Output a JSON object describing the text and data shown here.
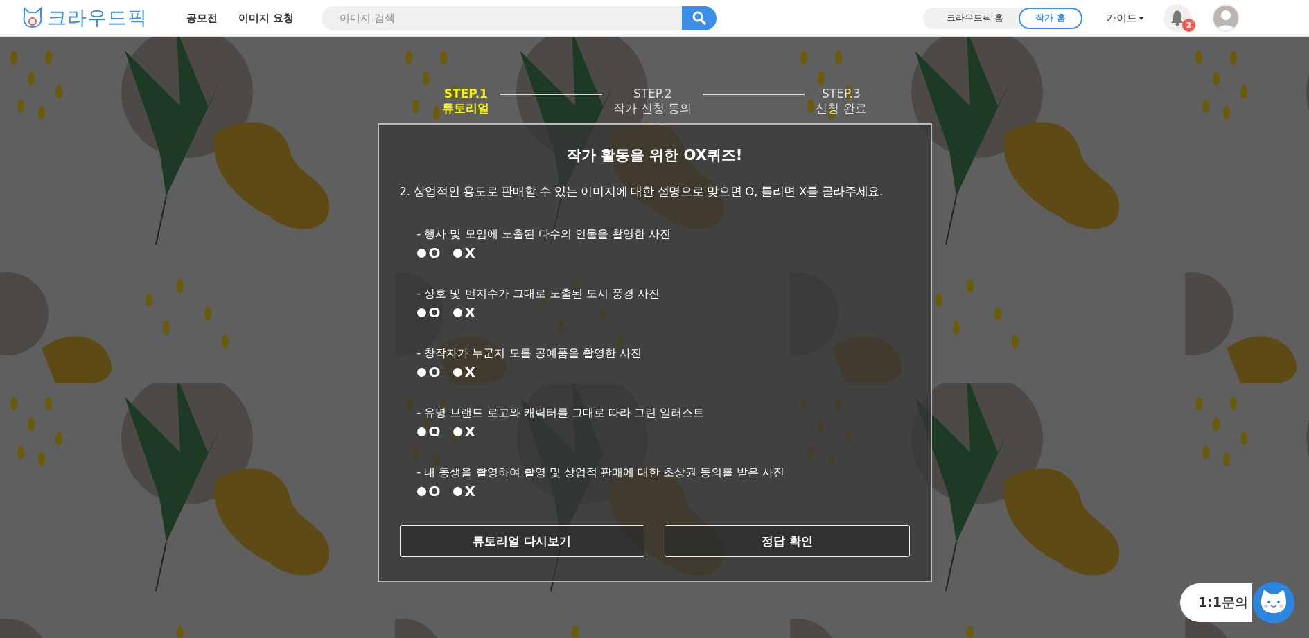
{
  "header": {
    "logo": "크라우드픽",
    "nav": [
      {
        "label": "공모전"
      },
      {
        "label": "이미지 요청"
      }
    ],
    "search": {
      "placeholder": "이미지 검색"
    },
    "home_toggle": [
      {
        "label": "크라우드픽 홈",
        "selected": false
      },
      {
        "label": "작가 홈",
        "selected": true
      }
    ],
    "guide": "가이드",
    "notification_count": "2"
  },
  "steps": [
    {
      "step": "STEP.1",
      "label": "튜토리얼",
      "selected": true
    },
    {
      "step": "STEP.2",
      "label": "작가 신청 동의",
      "selected": false
    },
    {
      "step": "STEP.3",
      "label": "신청 완료",
      "selected": false
    }
  ],
  "quiz": {
    "title": "작가 활동을 위한 OX퀴즈!",
    "question": "2. 상업적인 용도로 판매할 수 있는 이미지에 대한 설명으로 맞으면 O, 틀리면 X를 골라주세요.",
    "items": [
      {
        "text": "- 행사 및 모임에 노출된 다수의 인물을 촬영한 사진",
        "options": [
          {
            "label": "O",
            "selected": false
          },
          {
            "label": "X",
            "selected": false
          }
        ]
      },
      {
        "text": "- 상호 및 번지수가 그대로 노출된 도시 풍경 사진",
        "options": [
          {
            "label": "O",
            "selected": false
          },
          {
            "label": "X",
            "selected": false
          }
        ]
      },
      {
        "text": "- 창작자가 누군지 모를 공예품을 촬영한 사진",
        "options": [
          {
            "label": "O",
            "selected": false
          },
          {
            "label": "X",
            "selected": false
          }
        ]
      },
      {
        "text": "- 유명 브랜드 로고와 캐릭터를 그대로 따라 그린 일러스트",
        "options": [
          {
            "label": "O",
            "selected": false
          },
          {
            "label": "X",
            "selected": false
          }
        ]
      },
      {
        "text": "- 내 동생을 촬영하여 촬영 및 상업적 판매에 대한 초상권 동의를 받은 사진",
        "options": [
          {
            "label": "O",
            "selected": false
          },
          {
            "label": "X",
            "selected": false
          }
        ]
      }
    ]
  },
  "buttons": [
    "튜토리얼 다시보기",
    "정답 확인"
  ],
  "chat": {
    "label": "1:1문의"
  }
}
